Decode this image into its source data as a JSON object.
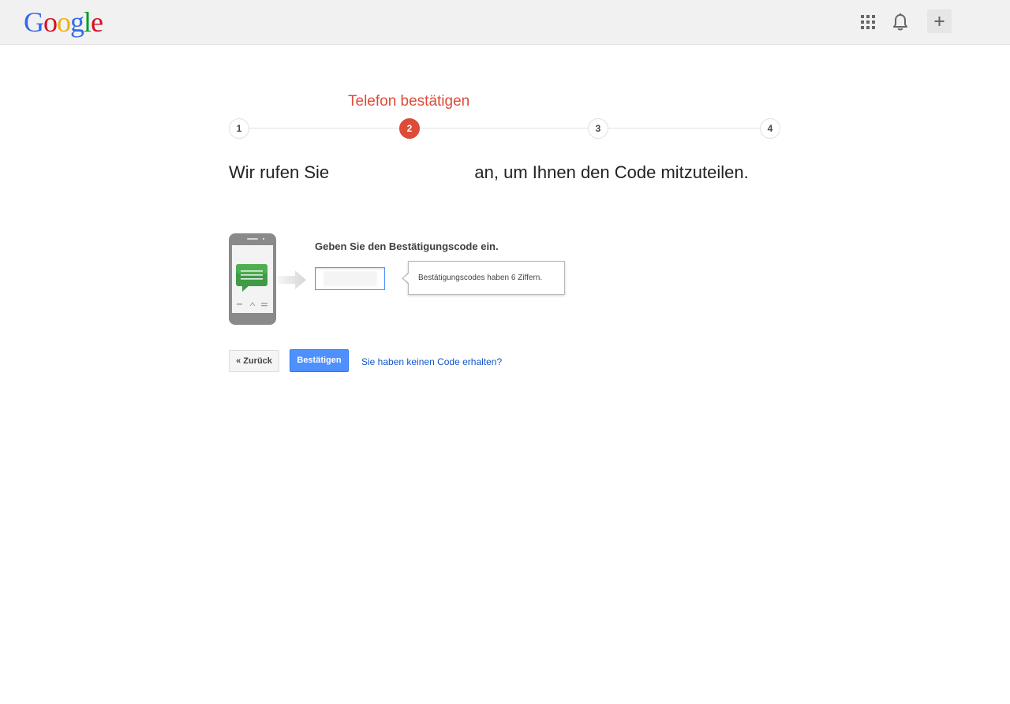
{
  "header": {
    "logo_letters": [
      "G",
      "o",
      "o",
      "g",
      "l",
      "e"
    ],
    "logo_colors": [
      "#3369e8",
      "#d50f25",
      "#eeb211",
      "#3369e8",
      "#009925",
      "#d50f25"
    ],
    "apps_icon": "apps-grid-icon",
    "notifications_icon": "bell-icon",
    "share_icon": "plus-icon"
  },
  "progress": {
    "current_step_title": "Telefon bestätigen",
    "steps": [
      "1",
      "2",
      "3",
      "4"
    ],
    "active_step": 2,
    "active_color": "#dd4b39"
  },
  "main": {
    "headline_before": "Wir rufen Sie",
    "headline_after": "an, um Ihnen den Code mitzuteilen.",
    "code_label": "Geben Sie den Bestätigungscode ein.",
    "code_value": "",
    "tooltip": "Bestätigungscodes haben 6 Ziffern."
  },
  "actions": {
    "back_label": "« Zurück",
    "confirm_label": "Bestätigen",
    "no_code_link": "Sie haben keinen Code erhalten?",
    "confirm_color": "#4d90fe",
    "link_color": "#1155cc"
  }
}
